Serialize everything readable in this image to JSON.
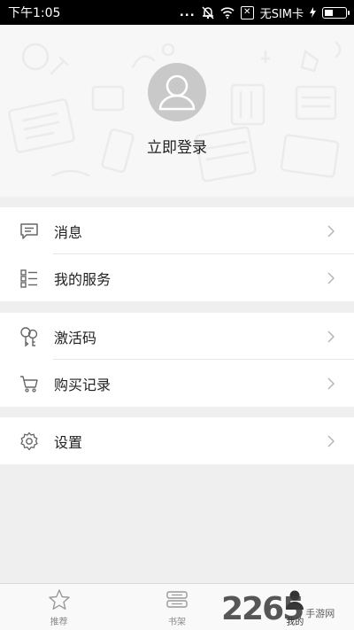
{
  "status_bar": {
    "time": "下午1:05",
    "dots": "...",
    "sim_glyph": "✕",
    "carrier": "无SIM卡",
    "icons": [
      "mute-icon",
      "wifi-icon",
      "sim-icon",
      "charging-icon",
      "battery-icon"
    ]
  },
  "profile": {
    "login_label": "立即登录",
    "avatar_icon": "avatar-placeholder-icon"
  },
  "menu_groups": [
    {
      "items": [
        {
          "label": "消息",
          "icon": "message-icon"
        },
        {
          "label": "我的服务",
          "icon": "service-list-icon"
        }
      ]
    },
    {
      "items": [
        {
          "label": "激活码",
          "icon": "key-icon"
        },
        {
          "label": "购买记录",
          "icon": "cart-icon"
        }
      ]
    },
    {
      "items": [
        {
          "label": "设置",
          "icon": "gear-icon"
        }
      ]
    }
  ],
  "bottom_nav": {
    "items": [
      {
        "label": "推荐",
        "icon": "star-icon",
        "active": false
      },
      {
        "label": "书架",
        "icon": "bookshelf-icon",
        "active": false
      },
      {
        "label": "我的",
        "icon": "user-icon",
        "active": true
      }
    ]
  },
  "watermark": {
    "number": "2265",
    "text": "手游网"
  },
  "colors": {
    "status_bar_bg": "#000000",
    "page_bg": "#efefef",
    "header_bg": "#f7f7f7",
    "avatar_bg": "#c9c9c9",
    "icon_gray": "#666666",
    "chevron_gray": "#b5b5b5"
  }
}
